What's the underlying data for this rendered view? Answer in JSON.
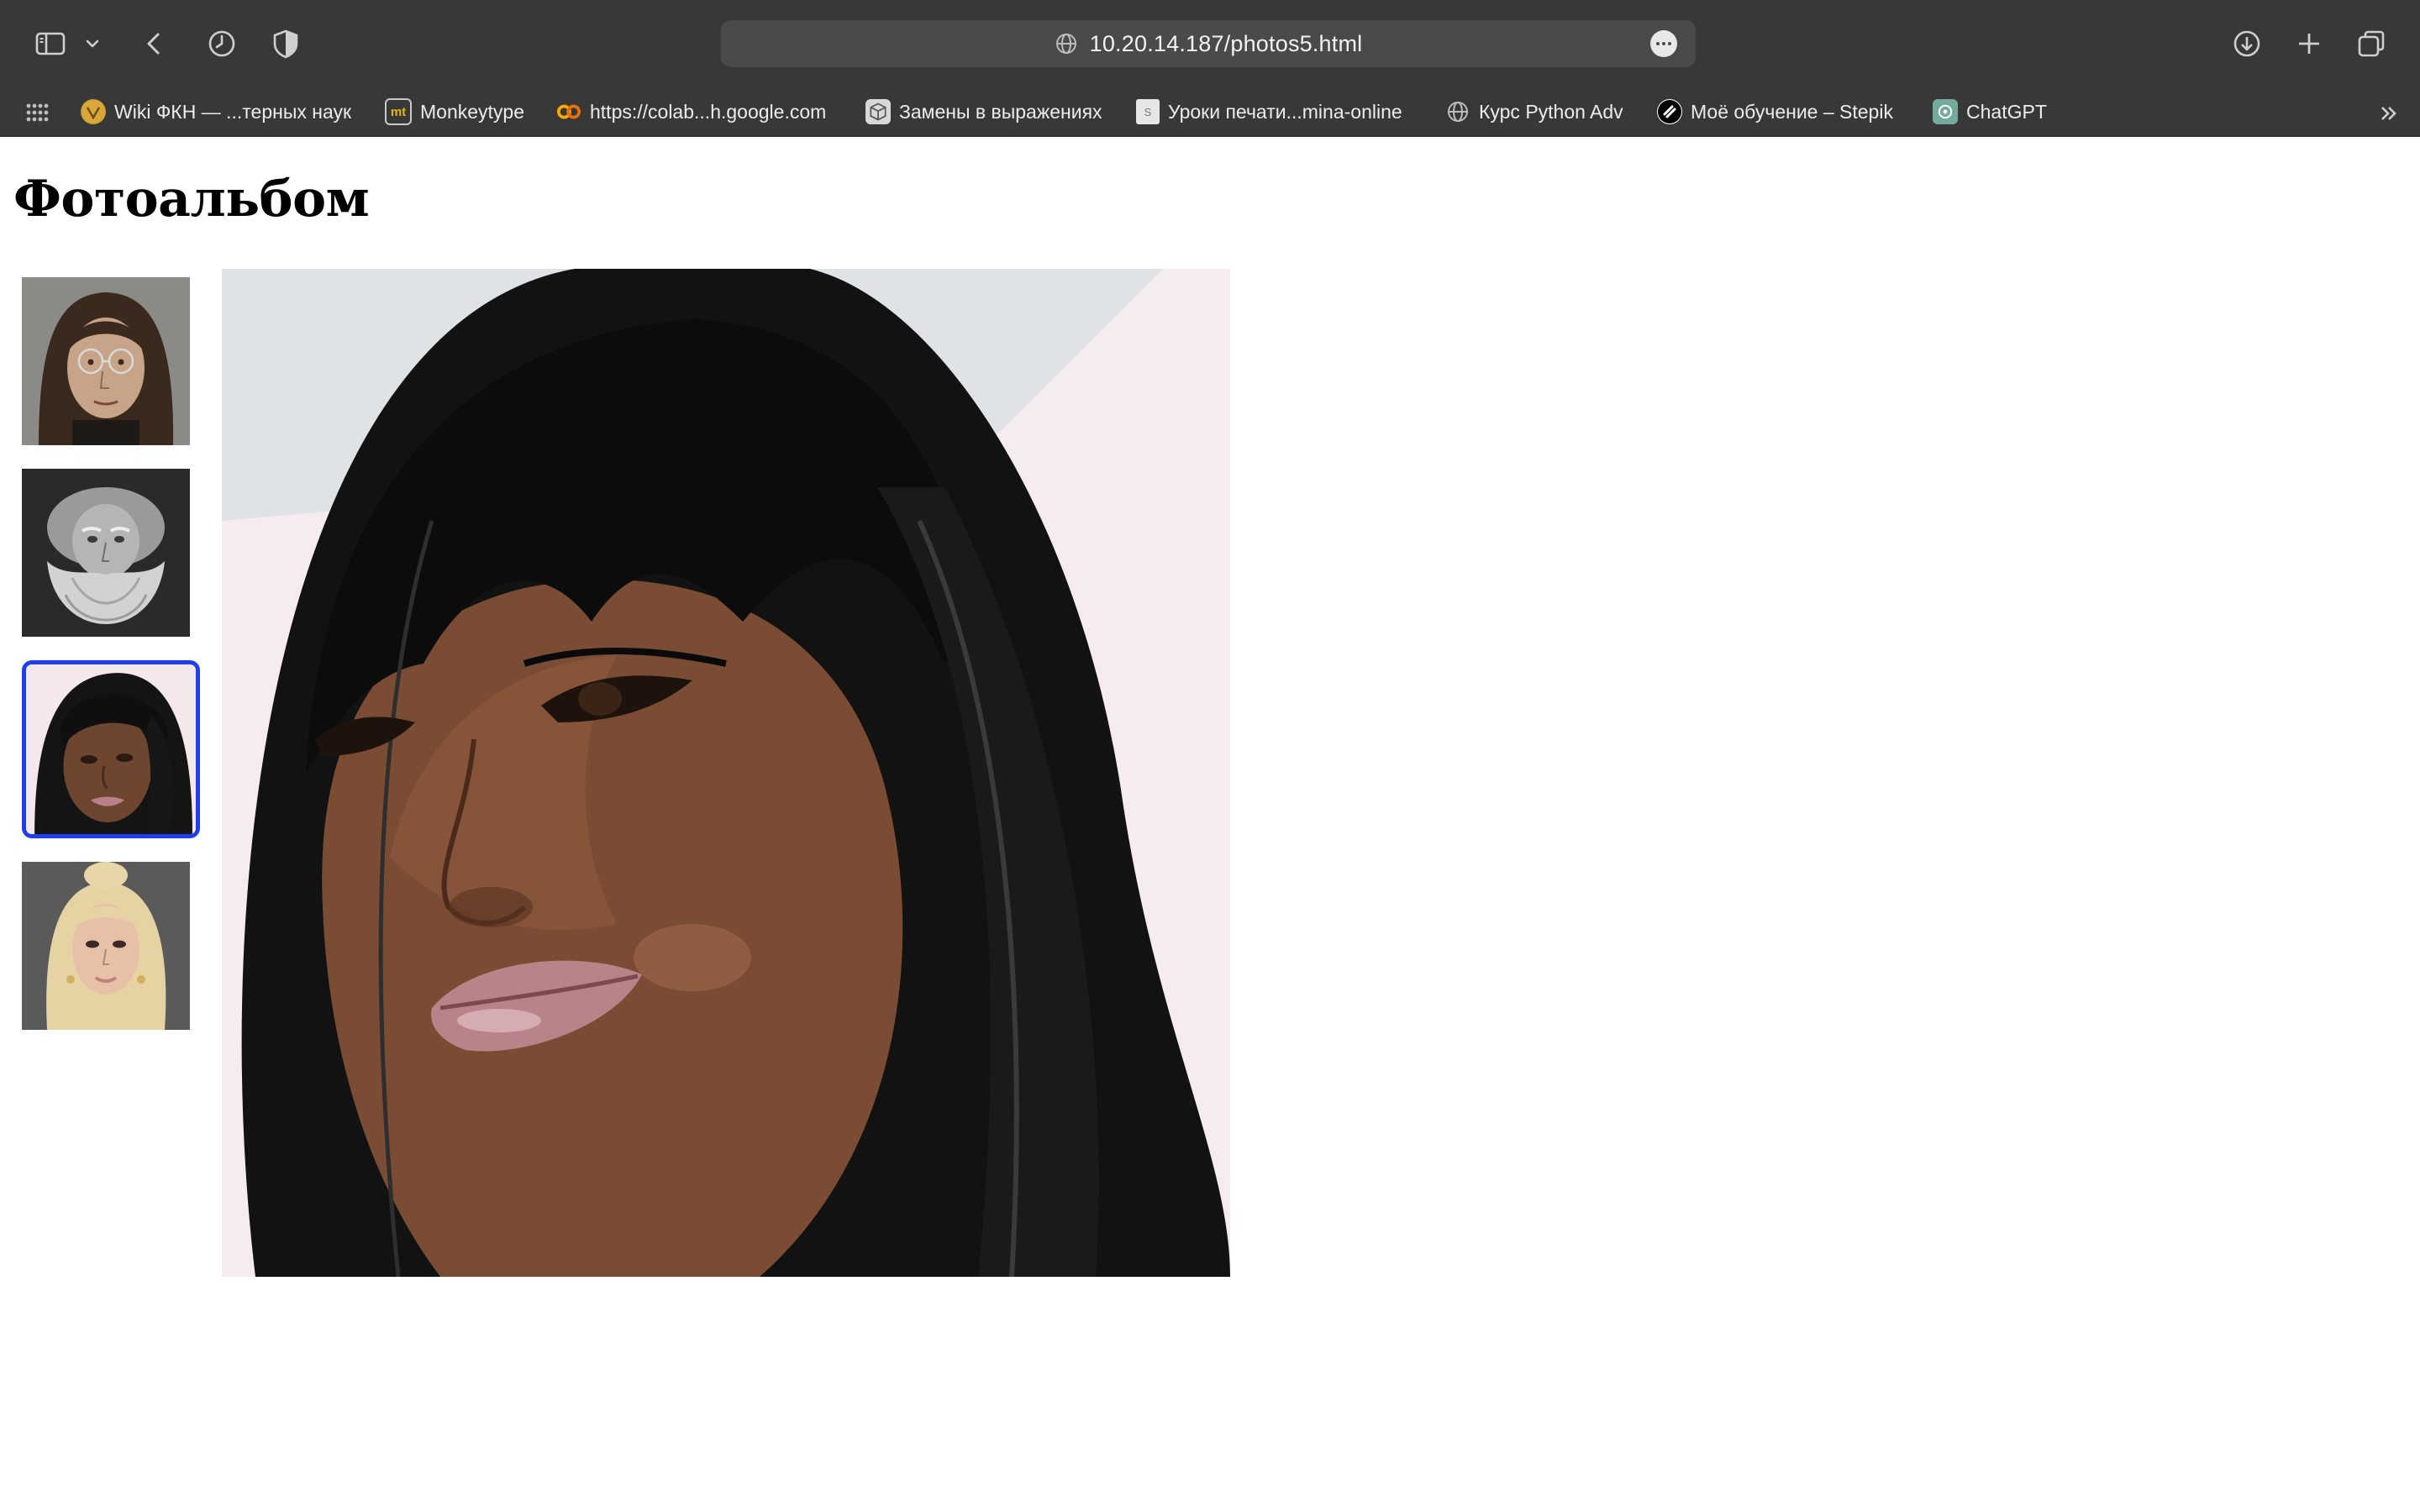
{
  "browser": {
    "url": "10.20.14.187/photos5.html",
    "accent_color": "#1d3ff0",
    "chrome_color": "#383838"
  },
  "bookmarks": [
    {
      "label": "Wiki ФКН — ...терных наук",
      "icon": "wiki-fkn-icon"
    },
    {
      "label": "Monkeytype",
      "icon": "monkeytype-icon"
    },
    {
      "label": "https://colab...h.google.com",
      "icon": "colab-icon"
    },
    {
      "label": "Замены в выражениях",
      "icon": "cube-icon"
    },
    {
      "label": "Уроки печати...mina-online",
      "icon": "page-icon"
    },
    {
      "label": "Курс Python Adv",
      "icon": "globe-icon"
    },
    {
      "label": "Моё обучение – Stepik",
      "icon": "stepik-icon"
    },
    {
      "label": "ChatGPT",
      "icon": "chatgpt-icon"
    }
  ],
  "page": {
    "title": "Фотоальбом"
  },
  "album": {
    "thumbnails": [
      {
        "name": "photo-1",
        "selected": false
      },
      {
        "name": "photo-2",
        "selected": false
      },
      {
        "name": "photo-3",
        "selected": true
      },
      {
        "name": "photo-4",
        "selected": false
      }
    ]
  }
}
